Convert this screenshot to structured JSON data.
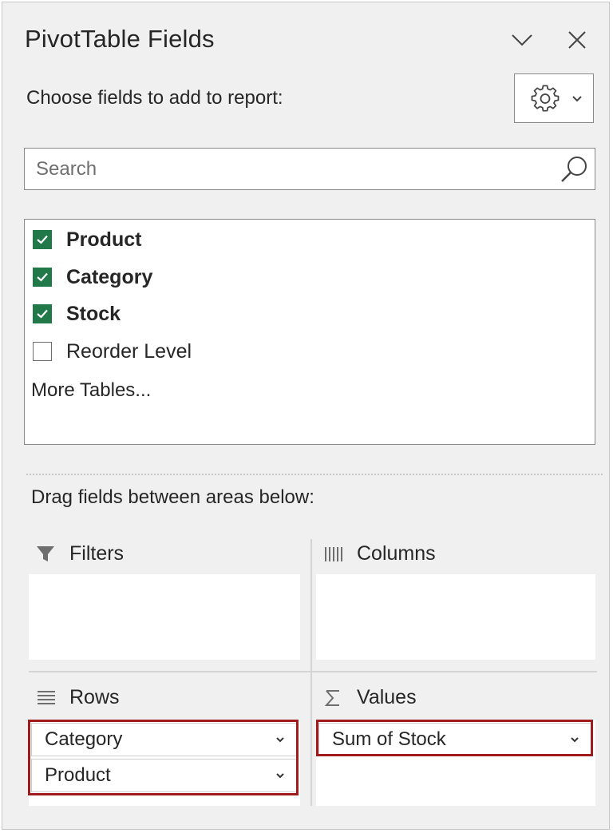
{
  "panel": {
    "title": "PivotTable Fields",
    "subtitle": "Choose fields to add to report:",
    "search_placeholder": "Search",
    "search_value": ""
  },
  "fields": [
    {
      "label": "Product",
      "checked": true
    },
    {
      "label": "Category",
      "checked": true
    },
    {
      "label": "Stock",
      "checked": true
    },
    {
      "label": "Reorder Level",
      "checked": false
    }
  ],
  "more_tables": "More Tables...",
  "drag_label": "Drag fields between areas below:",
  "areas": {
    "filters": {
      "label": "Filters",
      "icon": "filter-icon",
      "items": []
    },
    "columns": {
      "label": "Columns",
      "icon": "columns-icon",
      "items": []
    },
    "rows": {
      "label": "Rows",
      "icon": "rows-icon",
      "items": [
        "Category",
        "Product"
      ]
    },
    "values": {
      "label": "Values",
      "icon": "sigma-icon",
      "items": [
        "Sum of Stock"
      ]
    }
  },
  "colors": {
    "checkbox_checked": "#21794a",
    "highlight_border": "#a01c1c",
    "pane_bg": "#f0f0f0"
  }
}
